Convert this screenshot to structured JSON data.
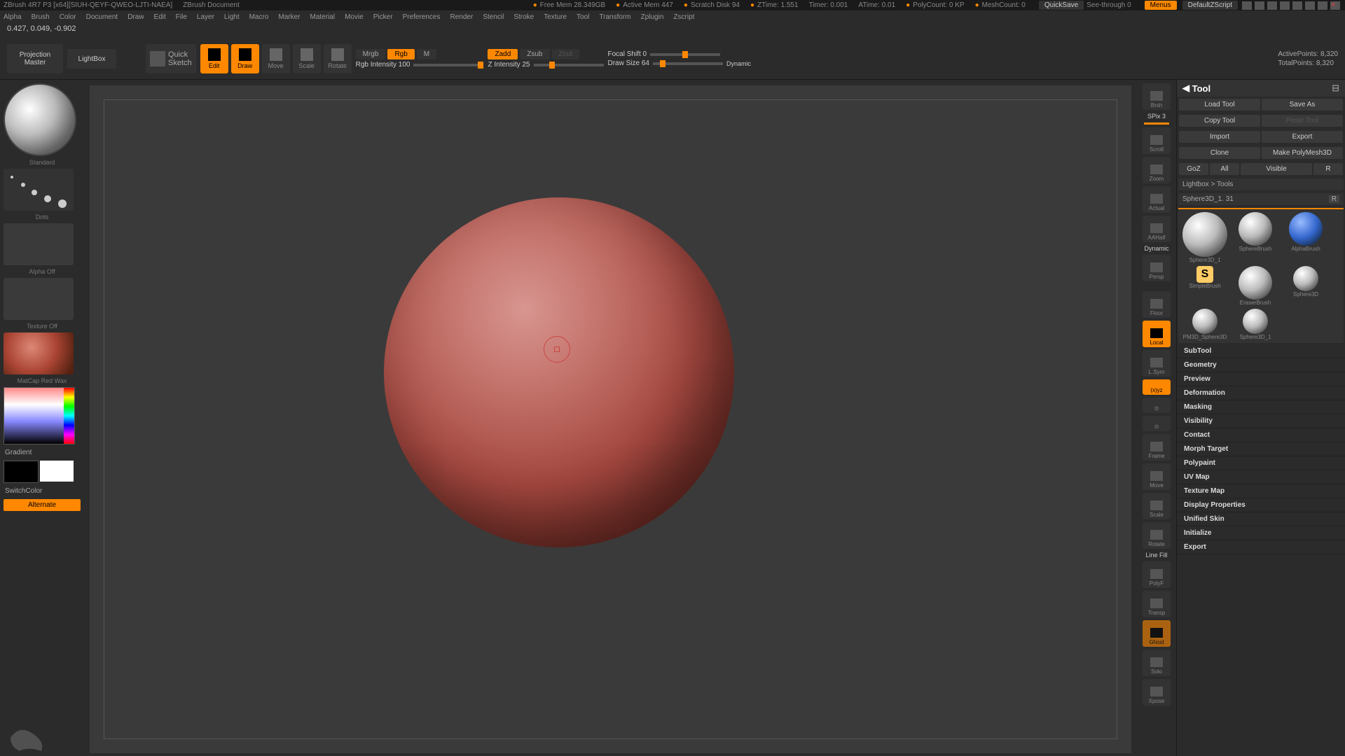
{
  "title": {
    "app": "ZBrush 4R7 P3 [x64][SIUH-QEYF-QWEO-LJTI-NAEA]",
    "doc": "ZBrush Document"
  },
  "status": {
    "freemem": "Free Mem 28.349GB",
    "actmem": "Active Mem 447",
    "scratch": "Scratch Disk 94",
    "ztime": "ZTime: 1.551",
    "timer": "Timer: 0.001",
    "atime": "ATime: 0.01",
    "poly": "PolyCount: 0 KP",
    "mesh": "MeshCount: 0"
  },
  "tbar": {
    "quicksave": "QuickSave",
    "seethru": "See-through",
    "seethruv": "0",
    "menus": "Menus",
    "script": "DefaultZScript"
  },
  "menu": [
    "Alpha",
    "Brush",
    "Color",
    "Document",
    "Draw",
    "Edit",
    "File",
    "Layer",
    "Light",
    "Macro",
    "Marker",
    "Material",
    "Movie",
    "Picker",
    "Preferences",
    "Render",
    "Stencil",
    "Stroke",
    "Texture",
    "Tool",
    "Transform",
    "Zplugin",
    "Zscript"
  ],
  "coords": "0.427, 0.049, -0.902",
  "shelf": {
    "pm1": "Projection",
    "pm2": "Master",
    "lightbox": "LightBox",
    "qs1": "Quick",
    "qs2": "Sketch",
    "buttons": [
      {
        "l": "Edit",
        "on": true
      },
      {
        "l": "Draw",
        "on": true
      },
      {
        "l": "Move",
        "on": false
      },
      {
        "l": "Scale",
        "on": false
      },
      {
        "l": "Rotate",
        "on": false
      }
    ],
    "mrgb": "Mrgb",
    "rgb": "Rgb",
    "m": "M",
    "rgbint": "Rgb Intensity 100",
    "zadd": "Zadd",
    "zsub": "Zsub",
    "zcut": "Zcut",
    "zint": "Z Intensity 25",
    "focal": "Focal Shift 0",
    "draw": "Draw Size 64",
    "dyn": "Dynamic",
    "active": "ActivePoints: 8,320",
    "total": "TotalPoints: 8,320"
  },
  "left": {
    "brush": "Standard",
    "stroke": "Dots",
    "alpha": "Alpha Off",
    "tex": "Texture Off",
    "mat": "MatCap Red Wax",
    "grad": "Gradient",
    "switch": "SwitchColor",
    "alt": "Alternate"
  },
  "rshelf": {
    "spix": "SPix 3",
    "items": [
      "Brsh",
      "Scroll",
      "Zoom",
      "Actual",
      "AAHalf"
    ],
    "dynlabel": "Dynamic",
    "persp": "Persp",
    "floor": "Floor",
    "local": "Local",
    "lsym": "L.Sym",
    "xyz": "(x)yz",
    "frame": "Frame",
    "move": "Move",
    "scale": "Scale",
    "rot": "Rotate",
    "pf": "Line Fill",
    "polyf": "PolyF",
    "transp": "Transp",
    "ghost": "Ghost",
    "solo": "Solo",
    "xpose": "Xpose"
  },
  "tool": {
    "header": "Tool",
    "row1": [
      "Load Tool",
      "Save As"
    ],
    "row2a": "Copy Tool",
    "row2b": "Paste Tool",
    "row3": [
      "Import",
      "Export"
    ],
    "row4": [
      "Clone",
      "Make PolyMesh3D"
    ],
    "row5": [
      "GoZ",
      "All",
      "Visible",
      "R"
    ],
    "lbx": "Lightbox > Tools",
    "cur": "Sphere3D_1. 31",
    "curR": "R",
    "cells": [
      {
        "n": "Sphere3D_1",
        "big": true
      },
      {
        "n": "SphereBrush"
      },
      {
        "n": "AlphaBrush",
        "c": "bl"
      },
      {
        "n": "SimpleBrush",
        "c": "or",
        "sidx": true
      },
      {
        "n": "EraserBrush"
      },
      {
        "n": "Sphere3D"
      },
      {
        "n": "PM3D_Sphere3D"
      },
      {
        "n": "Sphere3D_1"
      }
    ],
    "acc": [
      "SubTool",
      "Geometry",
      "Preview",
      "Deformation",
      "Masking",
      "Visibility",
      "Contact",
      "Morph Target",
      "Polypaint",
      "UV Map",
      "Texture Map",
      "Display Properties",
      "Unified Skin",
      "Initialize",
      "Export"
    ]
  }
}
